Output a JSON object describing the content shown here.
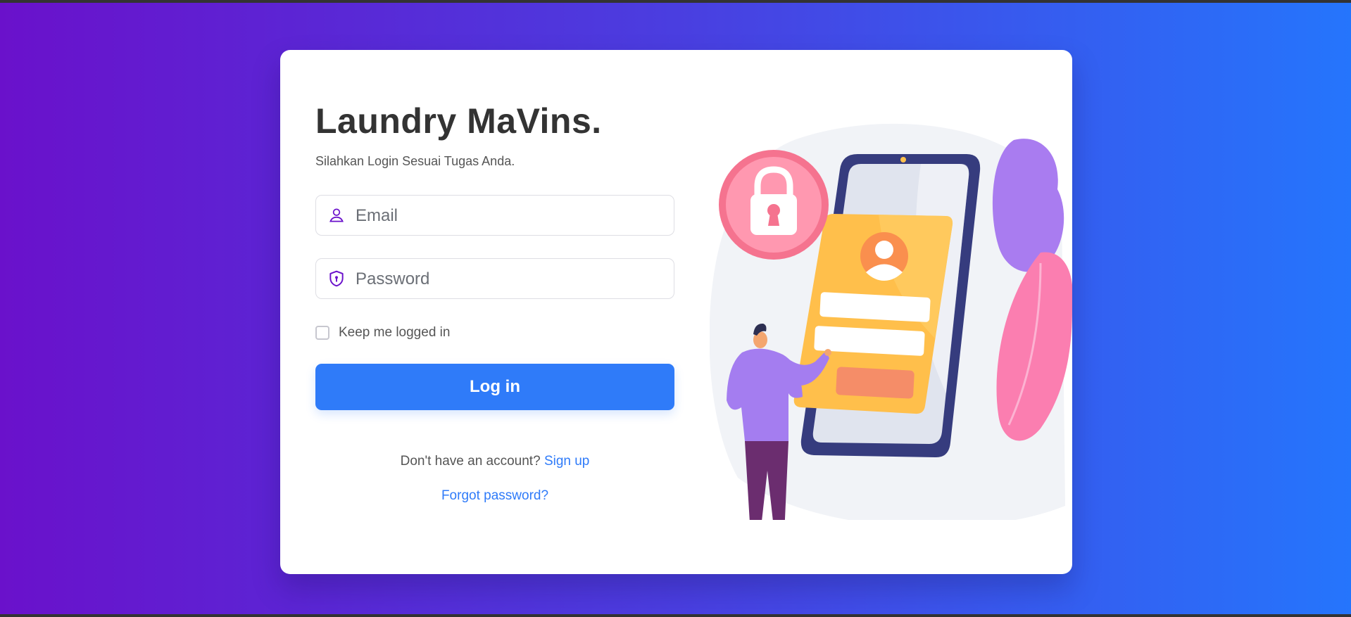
{
  "app": {
    "title": "Laundry MaVins.",
    "subtitle": "Silahkan Login Sesuai Tugas Anda."
  },
  "form": {
    "email_placeholder": "Email",
    "password_placeholder": "Password",
    "remember_label": "Keep me logged in",
    "remember_checked": false,
    "login_label": "Log in",
    "signup_prompt": "Don't have an account?",
    "signup_link": "Sign up",
    "forgot_link": "Forgot password?"
  },
  "icons": {
    "email": "user-icon",
    "password": "shield-keyhole-icon",
    "illustration": "login-phone-illustration"
  },
  "colors": {
    "background_start": "#6a11cb",
    "background_end": "#2575fc",
    "primary": "#2f7bf9",
    "icon_accent": "#6a11cb",
    "title": "#333333"
  }
}
